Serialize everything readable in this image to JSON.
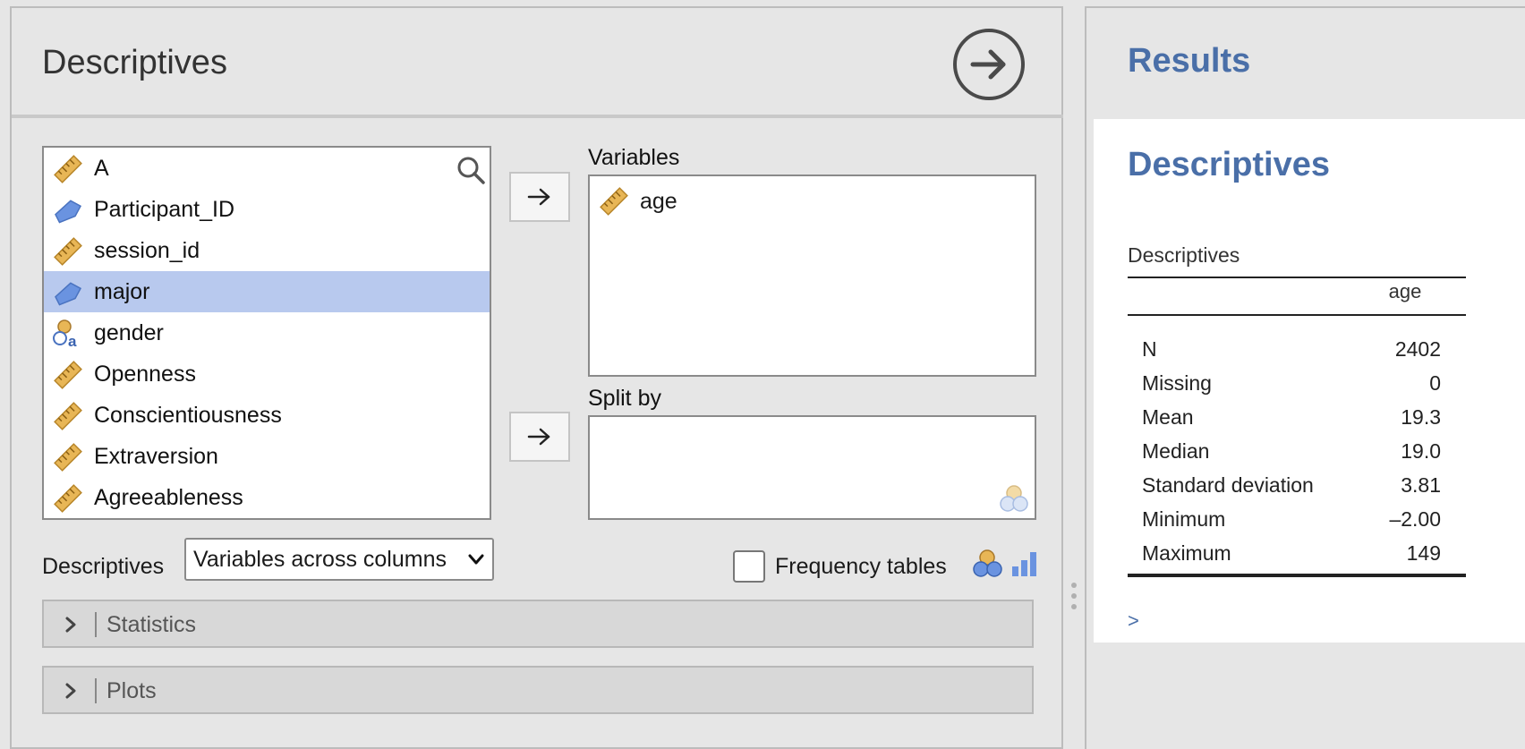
{
  "options": {
    "title": "Descriptives",
    "run_icon": "arrow-right-circle-icon",
    "variables": [
      {
        "label": "A",
        "type": "continuous",
        "icon": "ruler-icon"
      },
      {
        "label": "Participant_ID",
        "type": "id",
        "icon": "id-tag-icon"
      },
      {
        "label": "session_id",
        "type": "continuous",
        "icon": "ruler-icon"
      },
      {
        "label": "major",
        "type": "id",
        "icon": "id-tag-icon",
        "selected": true
      },
      {
        "label": "gender",
        "type": "nominal-text",
        "icon": "nominal-text-icon"
      },
      {
        "label": "Openness",
        "type": "continuous",
        "icon": "ruler-icon"
      },
      {
        "label": "Conscientiousness",
        "type": "continuous",
        "icon": "ruler-icon"
      },
      {
        "label": "Extraversion",
        "type": "continuous",
        "icon": "ruler-icon"
      },
      {
        "label": "Agreeableness",
        "type": "continuous",
        "icon": "ruler-icon"
      }
    ],
    "variables_box": {
      "label": "Variables",
      "items": [
        {
          "label": "age",
          "icon": "ruler-icon"
        }
      ]
    },
    "splitby_box": {
      "label": "Split by",
      "items": []
    },
    "descriptives_label": "Descriptives",
    "descriptives_select": {
      "value": "Variables across columns"
    },
    "frequency_tables": {
      "label": "Frequency tables",
      "checked": false
    },
    "sections": [
      {
        "label": "Statistics"
      },
      {
        "label": "Plots"
      }
    ]
  },
  "results": {
    "title": "Results",
    "card_title": "Descriptives",
    "table": {
      "caption": "Descriptives",
      "column": "age",
      "rows": [
        {
          "label": "N",
          "value": "2402"
        },
        {
          "label": "Missing",
          "value": "0"
        },
        {
          "label": "Mean",
          "value": "19.3"
        },
        {
          "label": "Median",
          "value": "19.0"
        },
        {
          "label": "Standard deviation",
          "value": "3.81"
        },
        {
          "label": "Minimum",
          "value": "–2.00"
        },
        {
          "label": "Maximum",
          "value": "149"
        }
      ]
    },
    "more_link": ">"
  },
  "colors": {
    "accent": "#4a6fa8",
    "selection": "#b8c9ee",
    "ruler": "#e8b656",
    "id_tag": "#6a93e0"
  }
}
